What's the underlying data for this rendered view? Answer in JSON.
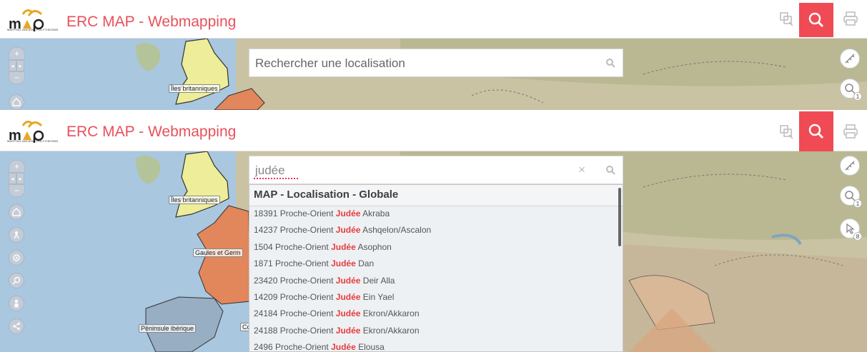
{
  "app": {
    "title": "ERC MAP - Webmapping",
    "logo_text": "MAP",
    "logo_tagline": "MAPPING ANCIENT POLYTHEISMS"
  },
  "colors": {
    "brand": "#e8505b",
    "search_active": "#f04b55",
    "highlight": "#e83c3c"
  },
  "header_buttons": [
    {
      "icon": "measure-tool-icon"
    },
    {
      "icon": "search-icon",
      "active": true
    },
    {
      "icon": "print-icon"
    }
  ],
  "map_labels": {
    "iles": "Îles britanniques",
    "gaules": "Gaules et Germ",
    "peninsule": "Péninsule ibérique",
    "co": "Co"
  },
  "right_tools": {
    "badge_info": "1",
    "badge_select": "8"
  },
  "search_top": {
    "placeholder": "Rechercher une localisation"
  },
  "search_bottom": {
    "value": "judée",
    "clear": "×"
  },
  "results": {
    "group_title": "MAP - Localisation - Globale",
    "items": [
      {
        "id": "18391",
        "region": "Proche-Orient",
        "match": "Judée",
        "name": "Akraba"
      },
      {
        "id": "14237",
        "region": "Proche-Orient",
        "match": "Judée",
        "name": "Ashqelon/Ascalon"
      },
      {
        "id": "1504",
        "region": "Proche-Orient",
        "match": "Judée",
        "name": "Asophon"
      },
      {
        "id": "1871",
        "region": "Proche-Orient",
        "match": "Judée",
        "name": "Dan"
      },
      {
        "id": "23420",
        "region": "Proche-Orient",
        "match": "Judée",
        "name": "Deir Alla"
      },
      {
        "id": "14209",
        "region": "Proche-Orient",
        "match": "Judée",
        "name": "Ein Yael"
      },
      {
        "id": "24184",
        "region": "Proche-Orient",
        "match": "Judée",
        "name": "Ekron/Akkaron"
      },
      {
        "id": "24188",
        "region": "Proche-Orient",
        "match": "Judée",
        "name": "Ekron/Akkaron"
      },
      {
        "id": "2496",
        "region": "Proche-Orient",
        "match": "Judée",
        "name": "Elousa"
      }
    ]
  }
}
